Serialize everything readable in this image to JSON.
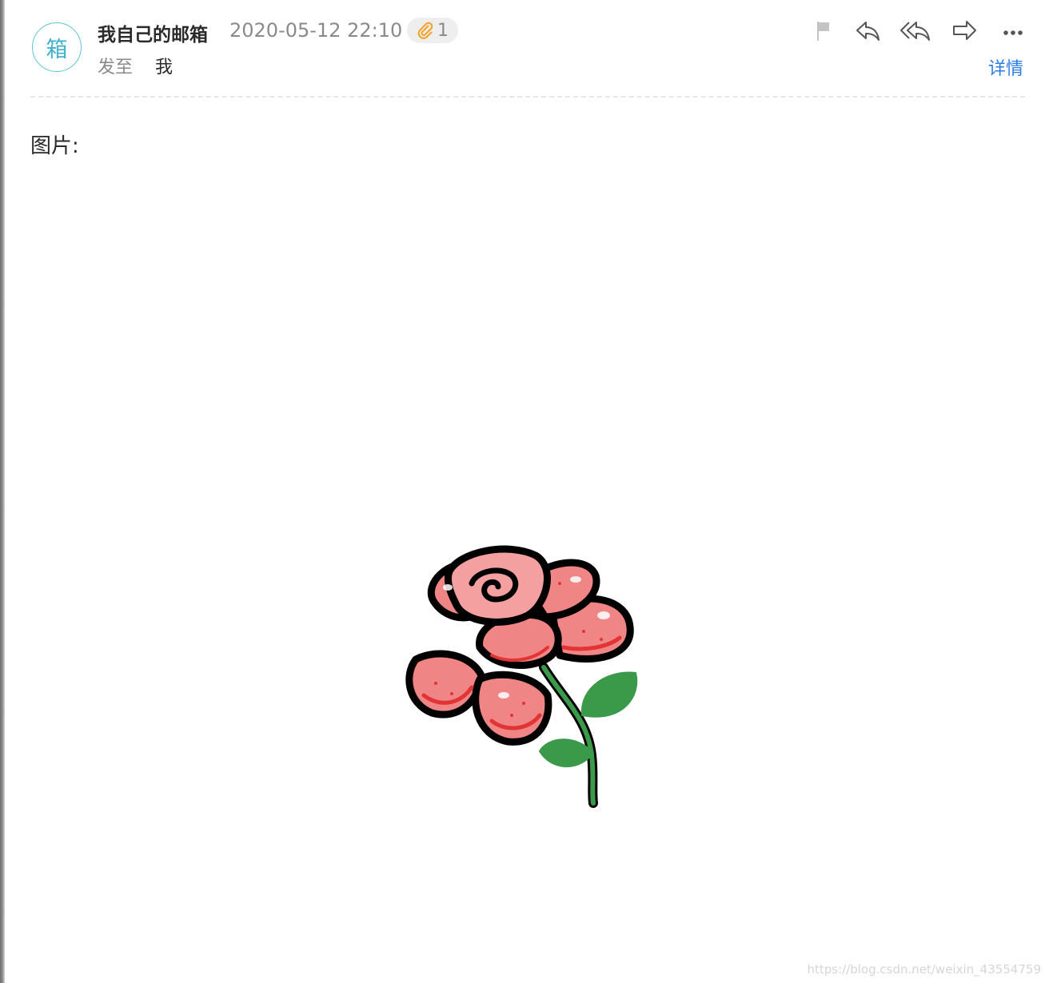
{
  "header": {
    "avatar_text": "箱",
    "sender_name": "我自己的邮箱",
    "timestamp": "2020-05-12 22:10",
    "attachment_count": "1",
    "to_label": "发至",
    "to_value": "我",
    "details_label": "详情"
  },
  "toolbar": {
    "icons": [
      "flag-icon",
      "reply-icon",
      "reply-all-icon",
      "forward-icon",
      "more-icon"
    ]
  },
  "body": {
    "text": "图片:",
    "image": "rose-illustration"
  },
  "watermark": "https://blog.csdn.net/weixin_43554759",
  "colors": {
    "avatar_accent": "#3fb1c9",
    "link": "#2b7de9",
    "paperclip": "#f5a024",
    "rose_red": "#f08585",
    "leaf_green": "#3a9a4a"
  }
}
